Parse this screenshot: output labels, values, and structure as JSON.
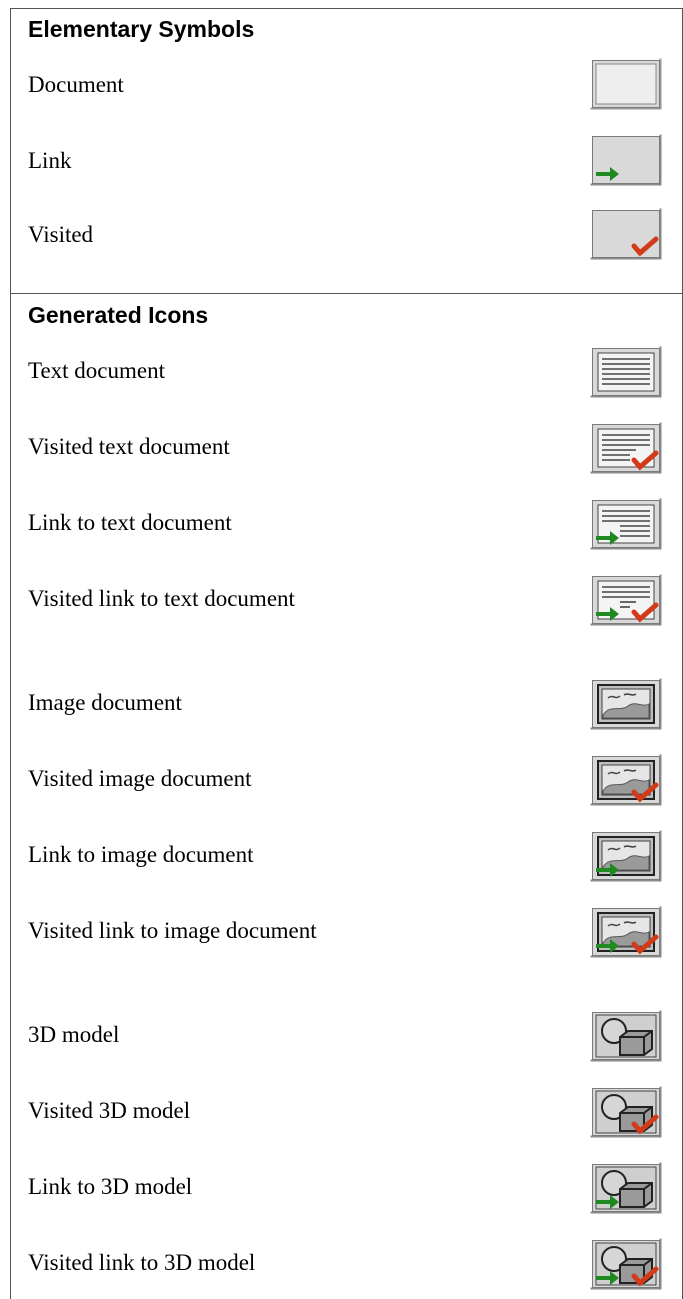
{
  "sections": [
    {
      "title": "Elementary Symbols",
      "items": [
        {
          "label": "Document",
          "icon": "document-icon"
        },
        {
          "label": "Link",
          "icon": "link-icon"
        },
        {
          "label": "Visited",
          "icon": "visited-icon"
        }
      ]
    },
    {
      "title": "Generated Icons",
      "items": [
        {
          "label": "Text document",
          "icon": "text-document-icon"
        },
        {
          "label": "Visited text document",
          "icon": "visited-text-document-icon"
        },
        {
          "label": "Link to text document",
          "icon": "link-text-document-icon"
        },
        {
          "label": "Visited link to text document",
          "icon": "visited-link-text-document-icon"
        },
        {
          "label": "Image document",
          "icon": "image-document-icon"
        },
        {
          "label": "Visited image document",
          "icon": "visited-image-document-icon"
        },
        {
          "label": "Link to image document",
          "icon": "link-image-document-icon"
        },
        {
          "label": "Visited link to image document",
          "icon": "visited-link-image-document-icon"
        },
        {
          "label": "3D model",
          "icon": "3d-model-icon"
        },
        {
          "label": "Visited 3D model",
          "icon": "visited-3d-model-icon"
        },
        {
          "label": "Link to 3D model",
          "icon": "link-3d-model-icon"
        },
        {
          "label": "Visited link to 3D model",
          "icon": "visited-link-3d-model-icon"
        }
      ]
    }
  ],
  "colors": {
    "link_arrow": "#1f8a1f",
    "visited_check": "#d23a1a",
    "icon_face": "#d9d9d9"
  }
}
